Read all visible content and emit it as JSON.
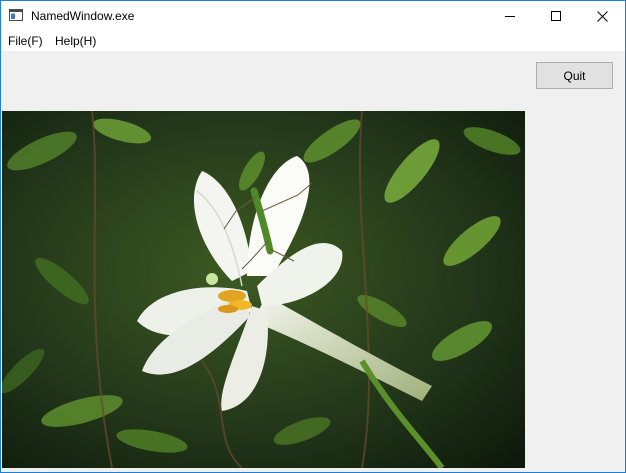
{
  "window": {
    "title": "NamedWindow.exe",
    "controls": {
      "minimize": "minimize-icon",
      "maximize": "maximize-icon",
      "close": "close-icon"
    }
  },
  "menu": {
    "items": [
      {
        "label": "File(F)"
      },
      {
        "label": "Help(H)"
      }
    ]
  },
  "toolbar": {
    "quit_label": "Quit"
  },
  "image": {
    "subject": "white lily flower with a green grasshopper on dark green foliage"
  },
  "colors": {
    "accent_border": "#1f7fd4",
    "client_bg": "#f0f0f0",
    "button_bg": "#e1e1e1"
  }
}
